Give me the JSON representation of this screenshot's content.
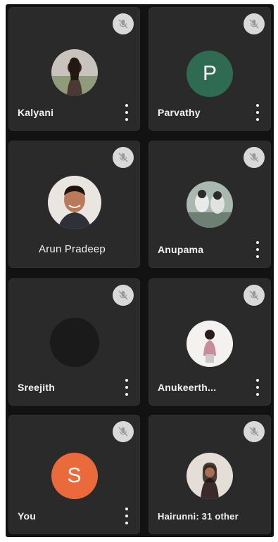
{
  "colors": {
    "background": "#121212",
    "tile": "#2a2a2a",
    "mute_bg": "#d9d9d9",
    "avatar_green": "#2e6b52",
    "avatar_orange": "#ea6a3c",
    "sreejith_avatar": "#1a1a1a"
  },
  "participants": [
    {
      "name": "Kalyani",
      "avatar": "photo",
      "muted": true,
      "has_menu": true
    },
    {
      "name": "Parvathy",
      "avatar": "letter",
      "avatar_letter": "P",
      "avatar_color": "#2e6b52",
      "muted": true,
      "has_menu": true
    },
    {
      "name": "Arun Pradeep",
      "avatar": "photo",
      "muted": true,
      "has_menu": false
    },
    {
      "name": "Anupama",
      "avatar": "photo",
      "muted": true,
      "has_menu": true
    },
    {
      "name": "Sreejith",
      "avatar": "dark-circle",
      "muted": true,
      "has_menu": true
    },
    {
      "name": "Anukeerth...",
      "avatar": "photo",
      "muted": true,
      "has_menu": true
    },
    {
      "name": "You",
      "avatar": "letter",
      "avatar_letter": "S",
      "avatar_color": "#ea6a3c",
      "muted": true,
      "has_menu": true
    },
    {
      "name": "Hairunni: 31 other",
      "avatar": "photo",
      "muted": true,
      "has_menu": false
    }
  ],
  "icons": {
    "mute": "mic-off-icon",
    "menu": "more-vertical-icon"
  }
}
